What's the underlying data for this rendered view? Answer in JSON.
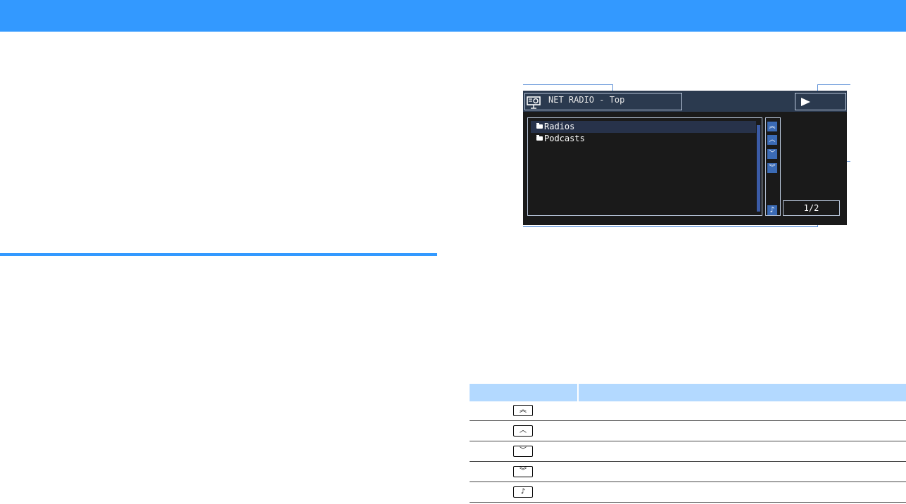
{
  "osd": {
    "title": "NET RADIO - Top",
    "list_items": [
      {
        "label": "Radios",
        "selected": true
      },
      {
        "label": "Podcasts",
        "selected": false
      }
    ],
    "page_indicator": "1/2",
    "nav_buttons": [
      "page-up-icon",
      "up-icon",
      "down-icon",
      "page-down-icon",
      "now-playing-icon"
    ]
  },
  "table": {
    "rows": [
      {
        "icon": "double-chevron-up-icon",
        "glyph": "︽"
      },
      {
        "icon": "chevron-up-icon",
        "glyph": "︿"
      },
      {
        "icon": "chevron-down-icon",
        "glyph": "﹀"
      },
      {
        "icon": "double-chevron-down-icon",
        "glyph": "︾"
      },
      {
        "icon": "music-note-icon",
        "glyph": "♪"
      }
    ]
  },
  "colors": {
    "accent": "#3399ff",
    "table_header": "#b3d9ff",
    "osd_background": "#1a1a1a",
    "osd_button": "#3b6bb5"
  }
}
